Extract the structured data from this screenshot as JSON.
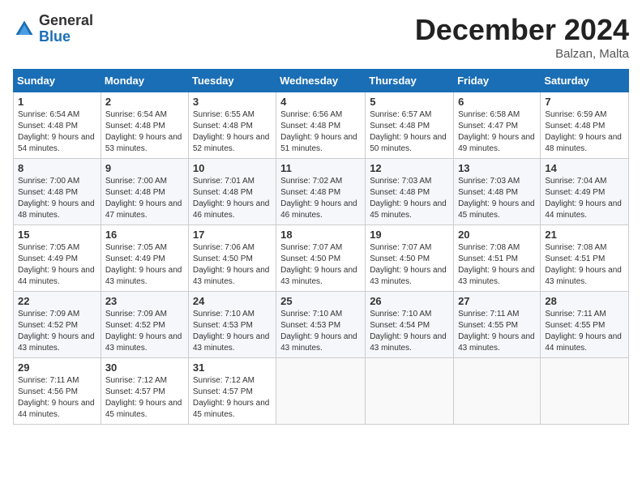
{
  "logo": {
    "general": "General",
    "blue": "Blue"
  },
  "header": {
    "title": "December 2024",
    "location": "Balzan, Malta"
  },
  "weekdays": [
    "Sunday",
    "Monday",
    "Tuesday",
    "Wednesday",
    "Thursday",
    "Friday",
    "Saturday"
  ],
  "weeks": [
    [
      {
        "day": "1",
        "info": "Sunrise: 6:54 AM\nSunset: 4:48 PM\nDaylight: 9 hours and 54 minutes."
      },
      {
        "day": "2",
        "info": "Sunrise: 6:54 AM\nSunset: 4:48 PM\nDaylight: 9 hours and 53 minutes."
      },
      {
        "day": "3",
        "info": "Sunrise: 6:55 AM\nSunset: 4:48 PM\nDaylight: 9 hours and 52 minutes."
      },
      {
        "day": "4",
        "info": "Sunrise: 6:56 AM\nSunset: 4:48 PM\nDaylight: 9 hours and 51 minutes."
      },
      {
        "day": "5",
        "info": "Sunrise: 6:57 AM\nSunset: 4:48 PM\nDaylight: 9 hours and 50 minutes."
      },
      {
        "day": "6",
        "info": "Sunrise: 6:58 AM\nSunset: 4:47 PM\nDaylight: 9 hours and 49 minutes."
      },
      {
        "day": "7",
        "info": "Sunrise: 6:59 AM\nSunset: 4:48 PM\nDaylight: 9 hours and 48 minutes."
      }
    ],
    [
      {
        "day": "8",
        "info": "Sunrise: 7:00 AM\nSunset: 4:48 PM\nDaylight: 9 hours and 48 minutes."
      },
      {
        "day": "9",
        "info": "Sunrise: 7:00 AM\nSunset: 4:48 PM\nDaylight: 9 hours and 47 minutes."
      },
      {
        "day": "10",
        "info": "Sunrise: 7:01 AM\nSunset: 4:48 PM\nDaylight: 9 hours and 46 minutes."
      },
      {
        "day": "11",
        "info": "Sunrise: 7:02 AM\nSunset: 4:48 PM\nDaylight: 9 hours and 46 minutes."
      },
      {
        "day": "12",
        "info": "Sunrise: 7:03 AM\nSunset: 4:48 PM\nDaylight: 9 hours and 45 minutes."
      },
      {
        "day": "13",
        "info": "Sunrise: 7:03 AM\nSunset: 4:48 PM\nDaylight: 9 hours and 45 minutes."
      },
      {
        "day": "14",
        "info": "Sunrise: 7:04 AM\nSunset: 4:49 PM\nDaylight: 9 hours and 44 minutes."
      }
    ],
    [
      {
        "day": "15",
        "info": "Sunrise: 7:05 AM\nSunset: 4:49 PM\nDaylight: 9 hours and 44 minutes."
      },
      {
        "day": "16",
        "info": "Sunrise: 7:05 AM\nSunset: 4:49 PM\nDaylight: 9 hours and 43 minutes."
      },
      {
        "day": "17",
        "info": "Sunrise: 7:06 AM\nSunset: 4:50 PM\nDaylight: 9 hours and 43 minutes."
      },
      {
        "day": "18",
        "info": "Sunrise: 7:07 AM\nSunset: 4:50 PM\nDaylight: 9 hours and 43 minutes."
      },
      {
        "day": "19",
        "info": "Sunrise: 7:07 AM\nSunset: 4:50 PM\nDaylight: 9 hours and 43 minutes."
      },
      {
        "day": "20",
        "info": "Sunrise: 7:08 AM\nSunset: 4:51 PM\nDaylight: 9 hours and 43 minutes."
      },
      {
        "day": "21",
        "info": "Sunrise: 7:08 AM\nSunset: 4:51 PM\nDaylight: 9 hours and 43 minutes."
      }
    ],
    [
      {
        "day": "22",
        "info": "Sunrise: 7:09 AM\nSunset: 4:52 PM\nDaylight: 9 hours and 43 minutes."
      },
      {
        "day": "23",
        "info": "Sunrise: 7:09 AM\nSunset: 4:52 PM\nDaylight: 9 hours and 43 minutes."
      },
      {
        "day": "24",
        "info": "Sunrise: 7:10 AM\nSunset: 4:53 PM\nDaylight: 9 hours and 43 minutes."
      },
      {
        "day": "25",
        "info": "Sunrise: 7:10 AM\nSunset: 4:53 PM\nDaylight: 9 hours and 43 minutes."
      },
      {
        "day": "26",
        "info": "Sunrise: 7:10 AM\nSunset: 4:54 PM\nDaylight: 9 hours and 43 minutes."
      },
      {
        "day": "27",
        "info": "Sunrise: 7:11 AM\nSunset: 4:55 PM\nDaylight: 9 hours and 43 minutes."
      },
      {
        "day": "28",
        "info": "Sunrise: 7:11 AM\nSunset: 4:55 PM\nDaylight: 9 hours and 44 minutes."
      }
    ],
    [
      {
        "day": "29",
        "info": "Sunrise: 7:11 AM\nSunset: 4:56 PM\nDaylight: 9 hours and 44 minutes."
      },
      {
        "day": "30",
        "info": "Sunrise: 7:12 AM\nSunset: 4:57 PM\nDaylight: 9 hours and 45 minutes."
      },
      {
        "day": "31",
        "info": "Sunrise: 7:12 AM\nSunset: 4:57 PM\nDaylight: 9 hours and 45 minutes."
      },
      null,
      null,
      null,
      null
    ]
  ]
}
